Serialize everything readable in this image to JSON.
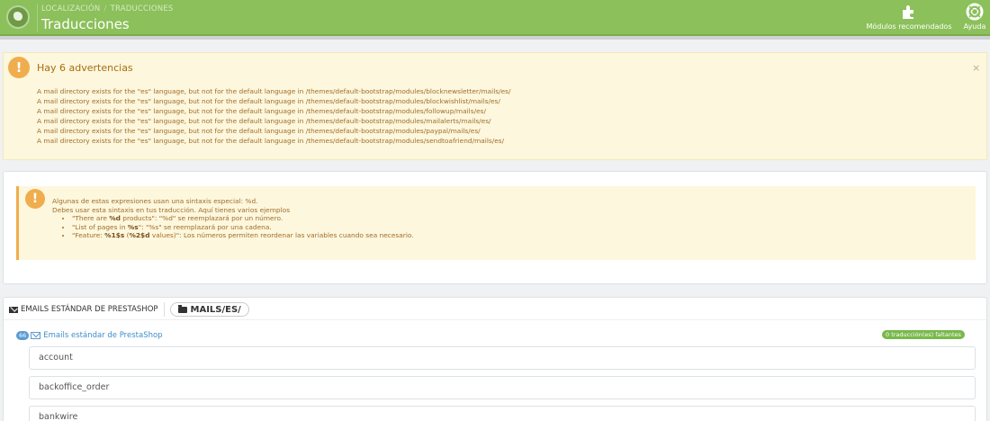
{
  "header": {
    "breadcrumb": [
      "LOCALIZACIÓN",
      "TRADUCCIONES"
    ],
    "breadcrumb_sep": "/",
    "title": "Traducciones",
    "toolbar": {
      "modules_label": "Módulos recomendados",
      "modules_icon": "puzzle-icon",
      "help_label": "Ayuda",
      "help_icon": "lifebuoy-icon"
    }
  },
  "warnings": {
    "title": "Hay 6 advertencias",
    "close": "×",
    "items": [
      "A mail directory exists for the \"es\" language, but not for the default language in /themes/default-bootstrap/modules/blocknewsletter/mails/es/",
      "A mail directory exists for the \"es\" language, but not for the default language in /themes/default-bootstrap/modules/blockwishlist/mails/es/",
      "A mail directory exists for the \"es\" language, but not for the default language in /themes/default-bootstrap/modules/followup/mails/es/",
      "A mail directory exists for the \"es\" language, but not for the default language in /themes/default-bootstrap/modules/mailalerts/mails/es/",
      "A mail directory exists for the \"es\" language, but not for the default language in /themes/default-bootstrap/modules/paypal/mails/es/",
      "A mail directory exists for the \"es\" language, but not for the default language in /themes/default-bootstrap/modules/sendtoafriend/mails/es/"
    ]
  },
  "info": {
    "line1": "Algunas de estas expresiones usan una sintaxis especial: %d.",
    "line2": "Debes usar esta sintaxis en tus traducción. Aquí tienes varios ejemplos",
    "ex1_a": "\"There are ",
    "ex1_b": "%d",
    "ex1_c": " products\": \"%d\" se reemplazará por un número.",
    "ex2_a": "\"List of pages in ",
    "ex2_b": "%s",
    "ex2_c": "\": \"%s\" se reemplazará por una cadena.",
    "ex3_a": "\"Feature: ",
    "ex3_b": "%1$s",
    "ex3_c": " (",
    "ex3_d": "%2$d",
    "ex3_e": " values)\": Los números permiten reordenar las variables cuando sea necesario."
  },
  "emails": {
    "section_label": "EMAILS ESTÁNDAR DE PRESTASHOP",
    "path": "MAILS/ES/",
    "count": "66",
    "group_title": "Emails estándar de PrestaShop",
    "missing": "0 traducción(es) faltantes",
    "items": [
      "account",
      "backoffice_order",
      "bankwire"
    ]
  }
}
